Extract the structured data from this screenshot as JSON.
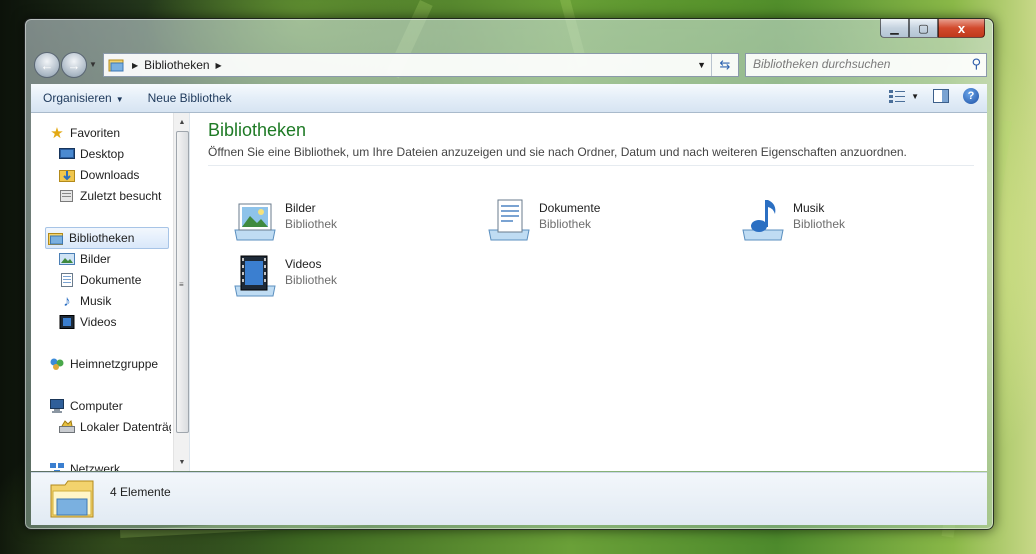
{
  "window": {
    "caption_buttons": {
      "minimize": "▁",
      "maximize": "▢",
      "close": "x"
    }
  },
  "address_bar": {
    "crumbs": [
      "Bibliotheken"
    ],
    "dropdown_icon": "chevron-down-icon",
    "refresh_icon": "refresh-icon"
  },
  "search": {
    "placeholder": "Bibliotheken durchsuchen"
  },
  "toolbar": {
    "organize_label": "Organisieren",
    "new_library_label": "Neue Bibliothek"
  },
  "sidebar": {
    "favorites_label": "Favoriten",
    "favorites": [
      {
        "label": "Desktop",
        "icon": "desktop-icon"
      },
      {
        "label": "Downloads",
        "icon": "downloads-folder-icon"
      },
      {
        "label": "Zuletzt besucht",
        "icon": "recent-places-icon"
      }
    ],
    "libraries_label": "Bibliotheken",
    "libraries": [
      {
        "label": "Bilder",
        "icon": "pictures-icon"
      },
      {
        "label": "Dokumente",
        "icon": "documents-icon"
      },
      {
        "label": "Musik",
        "icon": "music-icon"
      },
      {
        "label": "Videos",
        "icon": "videos-icon"
      }
    ],
    "homegroup_label": "Heimnetzgruppe",
    "computer_label": "Computer",
    "computer_items": [
      {
        "label": "Lokaler Datenträger",
        "icon": "local-disk-icon"
      }
    ],
    "network_label": "Netzwerk"
  },
  "main": {
    "title": "Bibliotheken",
    "subtitle": "Öffnen Sie eine Bibliothek, um Ihre Dateien anzuzeigen und sie nach Ordner, Datum und nach weiteren Eigenschaften anzuordnen.",
    "libraries": [
      {
        "name": "Bilder",
        "type": "Bibliothek",
        "icon": "pictures-library-icon"
      },
      {
        "name": "Dokumente",
        "type": "Bibliothek",
        "icon": "documents-library-icon"
      },
      {
        "name": "Musik",
        "type": "Bibliothek",
        "icon": "music-library-icon"
      },
      {
        "name": "Videos",
        "type": "Bibliothek",
        "icon": "videos-library-icon"
      }
    ]
  },
  "status_bar": {
    "item_count": "4 Elemente"
  }
}
